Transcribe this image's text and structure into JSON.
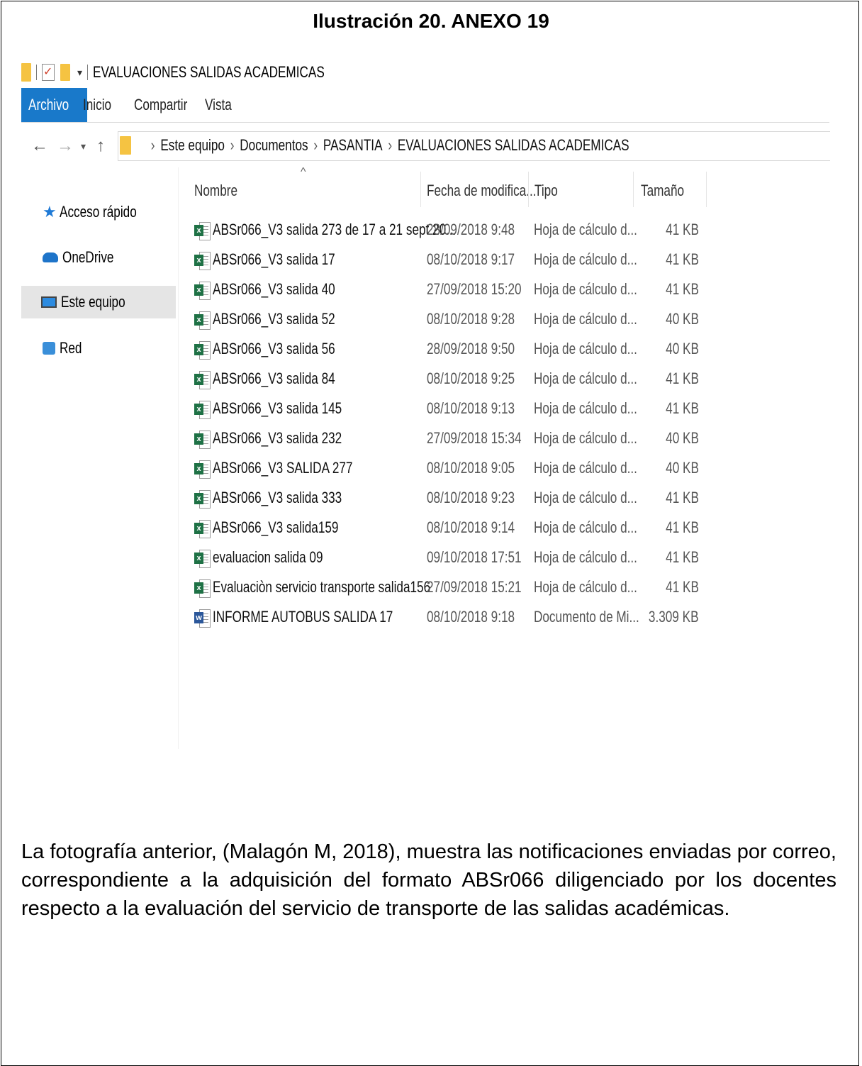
{
  "document": {
    "title": "Ilustración 20. ANEXO 19",
    "caption": "La fotografía anterior, (Malagón M, 2018), muestra las notificaciones enviadas por correo, correspondiente a la adquisición del formato ABSr066 diligenciado por los docentes respecto a la evaluación del servicio de transporte de las salidas académicas."
  },
  "window": {
    "title": "EVALUACIONES SALIDAS ACADEMICAS",
    "tabs": [
      "Archivo",
      "Inicio",
      "Compartir",
      "Vista"
    ],
    "active_tab": "Archivo",
    "breadcrumb": [
      "Este equipo",
      "Documentos",
      "PASANTIA",
      "EVALUACIONES SALIDAS ACADEMICAS"
    ]
  },
  "nav_pane": {
    "items": [
      {
        "label": "Acceso rápido",
        "icon": "star-icon"
      },
      {
        "label": "OneDrive",
        "icon": "cloud-icon"
      },
      {
        "label": "Este equipo",
        "icon": "computer-icon",
        "selected": true
      },
      {
        "label": "Red",
        "icon": "network-icon"
      }
    ]
  },
  "file_list": {
    "columns": {
      "name": "Nombre",
      "date": "Fecha de modifica...",
      "type": "Tipo",
      "size": "Tamaño"
    },
    "rows": [
      {
        "name": "ABSr066_V3  salida 273 de 17 a 21 sept 20...",
        "date": "28/09/2018 9:48",
        "type": "Hoja de cálculo d...",
        "size": "41 KB",
        "icon": "excel-file-icon"
      },
      {
        "name": "ABSr066_V3 salida 17",
        "date": "08/10/2018 9:17",
        "type": "Hoja de cálculo d...",
        "size": "41 KB",
        "icon": "excel-file-icon"
      },
      {
        "name": "ABSr066_V3 salida 40",
        "date": "27/09/2018 15:20",
        "type": "Hoja de cálculo d...",
        "size": "41 KB",
        "icon": "excel-file-icon"
      },
      {
        "name": "ABSr066_V3 salida 52",
        "date": "08/10/2018 9:28",
        "type": "Hoja de cálculo d...",
        "size": "40 KB",
        "icon": "excel-file-icon"
      },
      {
        "name": "ABSr066_V3 salida 56",
        "date": "28/09/2018 9:50",
        "type": "Hoja de cálculo d...",
        "size": "40 KB",
        "icon": "excel-file-icon"
      },
      {
        "name": "ABSr066_V3 salida 84",
        "date": "08/10/2018 9:25",
        "type": "Hoja de cálculo d...",
        "size": "41 KB",
        "icon": "excel-file-icon"
      },
      {
        "name": "ABSr066_V3 salida 145",
        "date": "08/10/2018 9:13",
        "type": "Hoja de cálculo d...",
        "size": "41 KB",
        "icon": "excel-file-icon"
      },
      {
        "name": "ABSr066_V3 salida 232",
        "date": "27/09/2018 15:34",
        "type": "Hoja de cálculo d...",
        "size": "40 KB",
        "icon": "excel-file-icon"
      },
      {
        "name": "ABSr066_V3 SALIDA 277",
        "date": "08/10/2018 9:05",
        "type": "Hoja de cálculo d...",
        "size": "40 KB",
        "icon": "excel-file-icon"
      },
      {
        "name": "ABSr066_V3 salida 333",
        "date": "08/10/2018 9:23",
        "type": "Hoja de cálculo d...",
        "size": "41 KB",
        "icon": "excel-file-icon"
      },
      {
        "name": "ABSr066_V3 salida159",
        "date": "08/10/2018 9:14",
        "type": "Hoja de cálculo d...",
        "size": "41 KB",
        "icon": "excel-file-icon"
      },
      {
        "name": "evaluacion salida 09",
        "date": "09/10/2018 17:51",
        "type": "Hoja de cálculo d...",
        "size": "41 KB",
        "icon": "excel-file-icon"
      },
      {
        "name": "Evaluaciòn servicio transporte salida156",
        "date": "27/09/2018 15:21",
        "type": "Hoja de cálculo d...",
        "size": "41 KB",
        "icon": "excel-file-icon"
      },
      {
        "name": "INFORME AUTOBUS SALIDA 17",
        "date": "08/10/2018 9:18",
        "type": "Documento de Mi...",
        "size": "3.309 KB",
        "icon": "word-file-icon"
      }
    ]
  },
  "colors": {
    "ribbon_active": "#1979ca",
    "folder": "#f5c342",
    "excel": "#1e7145",
    "word": "#2b579a"
  }
}
